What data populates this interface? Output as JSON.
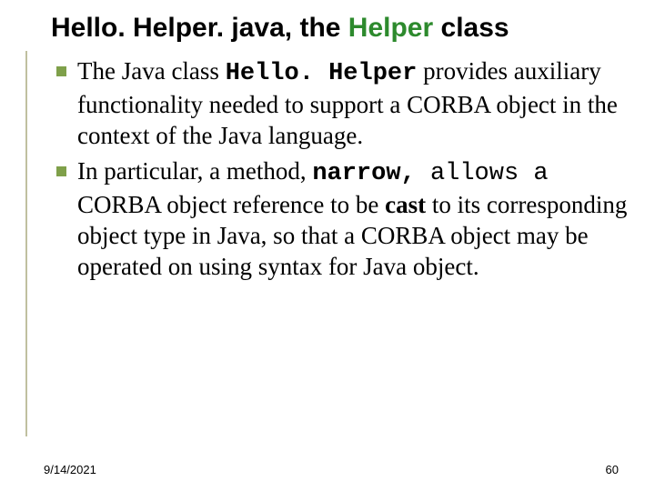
{
  "title": {
    "part1": "Hello. Helper. java, the ",
    "highlight": "Helper",
    "part2": " class"
  },
  "items": [
    {
      "pre": "The Java class ",
      "code": "Hello. Helper",
      "post": " provides auxiliary functionality needed to support a CORBA object in the context of the Java language."
    },
    {
      "pre": "In particular, a method, ",
      "code": "narrow, ",
      "mid_mono": " allows a ",
      "post1": "CORBA object reference to be ",
      "bold": "cast",
      "post2": " to its corresponding object type in Java, so that a CORBA object may be operated on using syntax for Java object."
    }
  ],
  "footer": {
    "date": "9/14/2021",
    "page": "60"
  }
}
